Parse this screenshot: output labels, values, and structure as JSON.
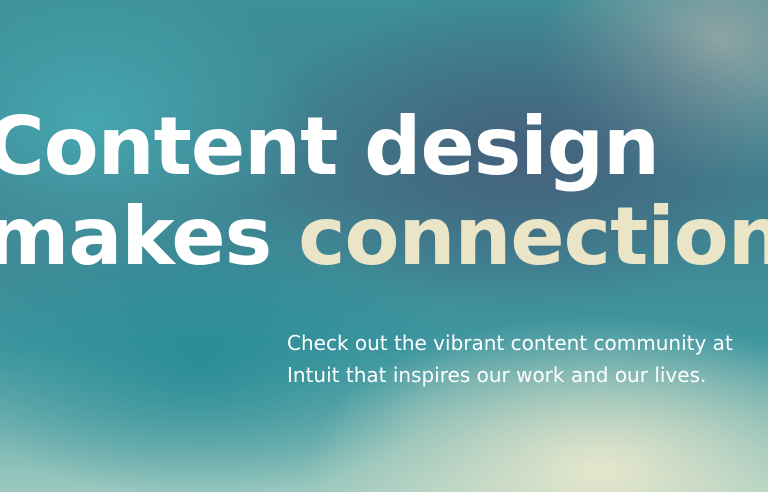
{
  "hero": {
    "headline": {
      "line1": "Content design",
      "line2_prefix": "makes ",
      "line2_accent": "connections"
    },
    "subcopy": {
      "line1": "Check out the vibrant content community at",
      "line2": "Intuit that inspires our work and our lives."
    },
    "colors": {
      "headline_text": "#ffffff",
      "headline_accent": "#ebe5c8",
      "subcopy_text": "#ffffff"
    }
  }
}
